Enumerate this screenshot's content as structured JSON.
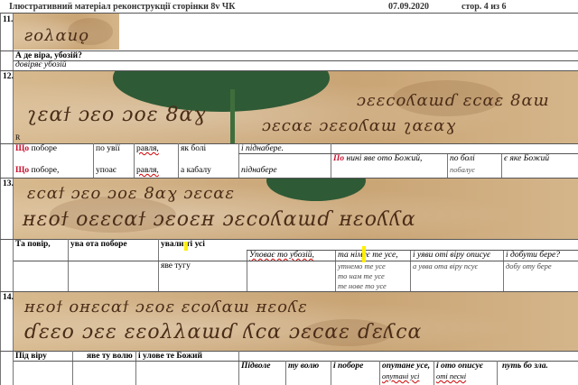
{
  "header": {
    "title": "Ілюстративний матеріал реконструкції сторінки 8v  ЧК",
    "date": "07.09.2020",
    "page": "стор. 4 из 6"
  },
  "rows": {
    "r11": {
      "num": "11.",
      "question": "А де віра, убозій?",
      "answer": "довіряє убозій"
    },
    "r12": {
      "num": "12.",
      "marker": "R",
      "line1": {
        "w1_red": "Що",
        "w1_rest": " поборе",
        "w2": "по увії",
        "w3": "равля,",
        "w4": "як болі",
        "w5": "і піднаберe."
      },
      "line2": {
        "red": "По",
        "red_rest": " нині яве ото Божий,",
        "c2": "по болі",
        "c3": "є яке Божий",
        "c3b": "побалує"
      },
      "line3": {
        "w1_red": "Що",
        "w1_rest": " поборе,",
        "w2": "упоає",
        "w3": "равля,",
        "w4": "а кабалу",
        "w5": "піднаберe"
      }
    },
    "r13": {
      "num": "13.",
      "line1": {
        "c1": "Та повір,",
        "c2": "ува ота поборе",
        "c3": "ували ті усі"
      },
      "line2": {
        "c1": "Уповає то убозій,",
        "c2": "та німує те усе,",
        "c3": "і уяви оті віру описує",
        "c4": "і добути бере?"
      },
      "line3": {
        "c1": "яве тугу",
        "c2a": "утнемо те усе",
        "c2b": "то нам те усе",
        "c2c": "те нове то усе",
        "c3": "а увва ота віру псує",
        "c4": "добу оту бере"
      }
    },
    "r14": {
      "num": "14.",
      "line1": {
        "c1": "Під віру",
        "c2": "яве ту волю",
        "c3": "і улове те Божий"
      },
      "line2": {
        "c1": "Підволе",
        "c2": "ту волю",
        "c3": "і поборе",
        "c4": "опутане усе,",
        "c4b": "опутані усі",
        "c5": "і ото описує",
        "c5b": "оті песні",
        "c6": "путь бо зла."
      }
    }
  },
  "manuscript": {
    "strip11": "ƨoλαиǫ",
    "strip12a": "ʅɛαϯ ɔɛo ɔoɛ 8αɣ",
    "strip12b": "ɔɛɛcoʎαɯɗ ɛcαɛ 8αɯ",
    "strip12c": "ɔɛcαɛ ɔɛɛoʎαɯ ʅαɛαɣ",
    "strip13a": "ɛcαϯ ɔɛo ɔoɛ 8αɣ   ɔɛcαɛ",
    "strip13b": "ʜɛoϯ oɛɛcαϯ ɔɛoɛʜ   ɔɛcoʎαɯɗ ʜɛoʎʎα",
    "strip14a": "ʜɛoϯ oʜɛcαϯ ɔɛoɛ   ɛcoʎαɯ ʜɛoʎɛ",
    "strip14b": "ɗɛɛo ɔɛɛ ɛɛoλλαɯɗ   ʎcα ɔɛcαɛ ɗɛʎcα"
  }
}
